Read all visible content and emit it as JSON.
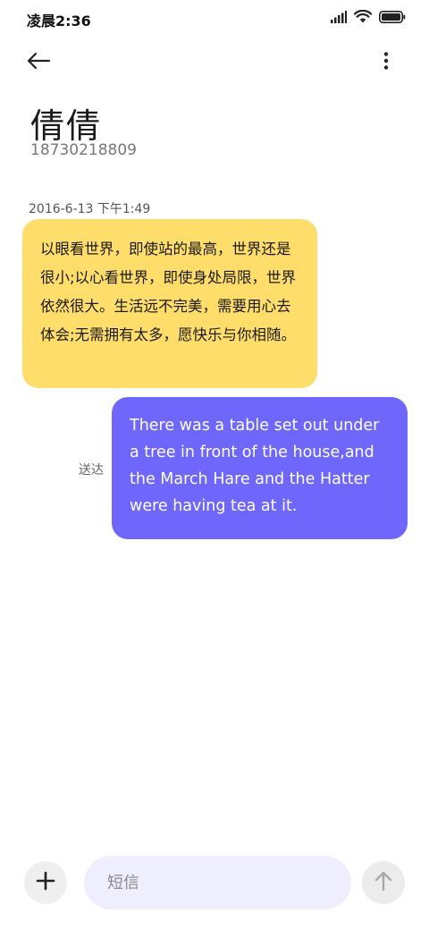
{
  "status_bar": {
    "time": "凌晨2:36",
    "icons": [
      "signal-icon",
      "wifi-icon",
      "battery-icon"
    ]
  },
  "top_bar": {
    "icons": [
      "back-arrow-icon",
      "more-vertical-icon"
    ]
  },
  "contact": {
    "name": "倩倩",
    "number": "18730218809"
  },
  "conversation": {
    "timestamp": "2016-6-13 下午1:49",
    "incoming_message": "以眼看世界，即使站的最高，世界还是很小;以心看世界，即使身处局限，世界依然很大。生活远不完美，需要用心去体会;无需拥有太多，愿快乐与你相随。",
    "outgoing_message": "There was a table set out under a tree in front of the house,and the March Hare and the Hatter were having tea at it.",
    "delivery_status": "送达"
  },
  "composer": {
    "placeholder": "短信",
    "value": "",
    "icons": [
      "plus-icon",
      "send-arrow-up-icon"
    ]
  },
  "colors": {
    "incoming_bubble": "#fedd6b",
    "outgoing_bubble": "#6f67fb",
    "input_background": "#efeefe",
    "button_background": "#efefef"
  }
}
